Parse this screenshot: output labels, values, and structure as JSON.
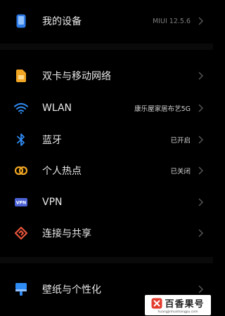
{
  "rows": [
    {
      "label": "我的设备",
      "value": "MIUI 12.5.6",
      "icon": "phone-icon",
      "color": "#2f7be8"
    },
    {
      "label": "双卡与移动网络",
      "value": "",
      "icon": "sim-card-icon",
      "color": "#f0a623"
    },
    {
      "label": "WLAN",
      "value": "康乐屋家居布艺5G",
      "icon": "wifi-icon",
      "color": "#2f8cf5"
    },
    {
      "label": "蓝牙",
      "value": "已开启",
      "icon": "bluetooth-icon",
      "color": "#2f8cf5"
    },
    {
      "label": "个人热点",
      "value": "已关闭",
      "icon": "hotspot-icon",
      "color": "#f0a623"
    },
    {
      "label": "VPN",
      "value": "",
      "icon": "vpn-icon",
      "color": "#4b62d6",
      "badge": "VPN"
    },
    {
      "label": "连接与共享",
      "value": "",
      "icon": "connection-share-icon",
      "color": "#e8553a"
    },
    {
      "label": "壁纸与个性化",
      "value": "",
      "icon": "wallpaper-icon",
      "color": "#2f8cf5"
    }
  ],
  "watermark": {
    "title": "百香果号",
    "url": "huangjinhuishangpu.com"
  }
}
